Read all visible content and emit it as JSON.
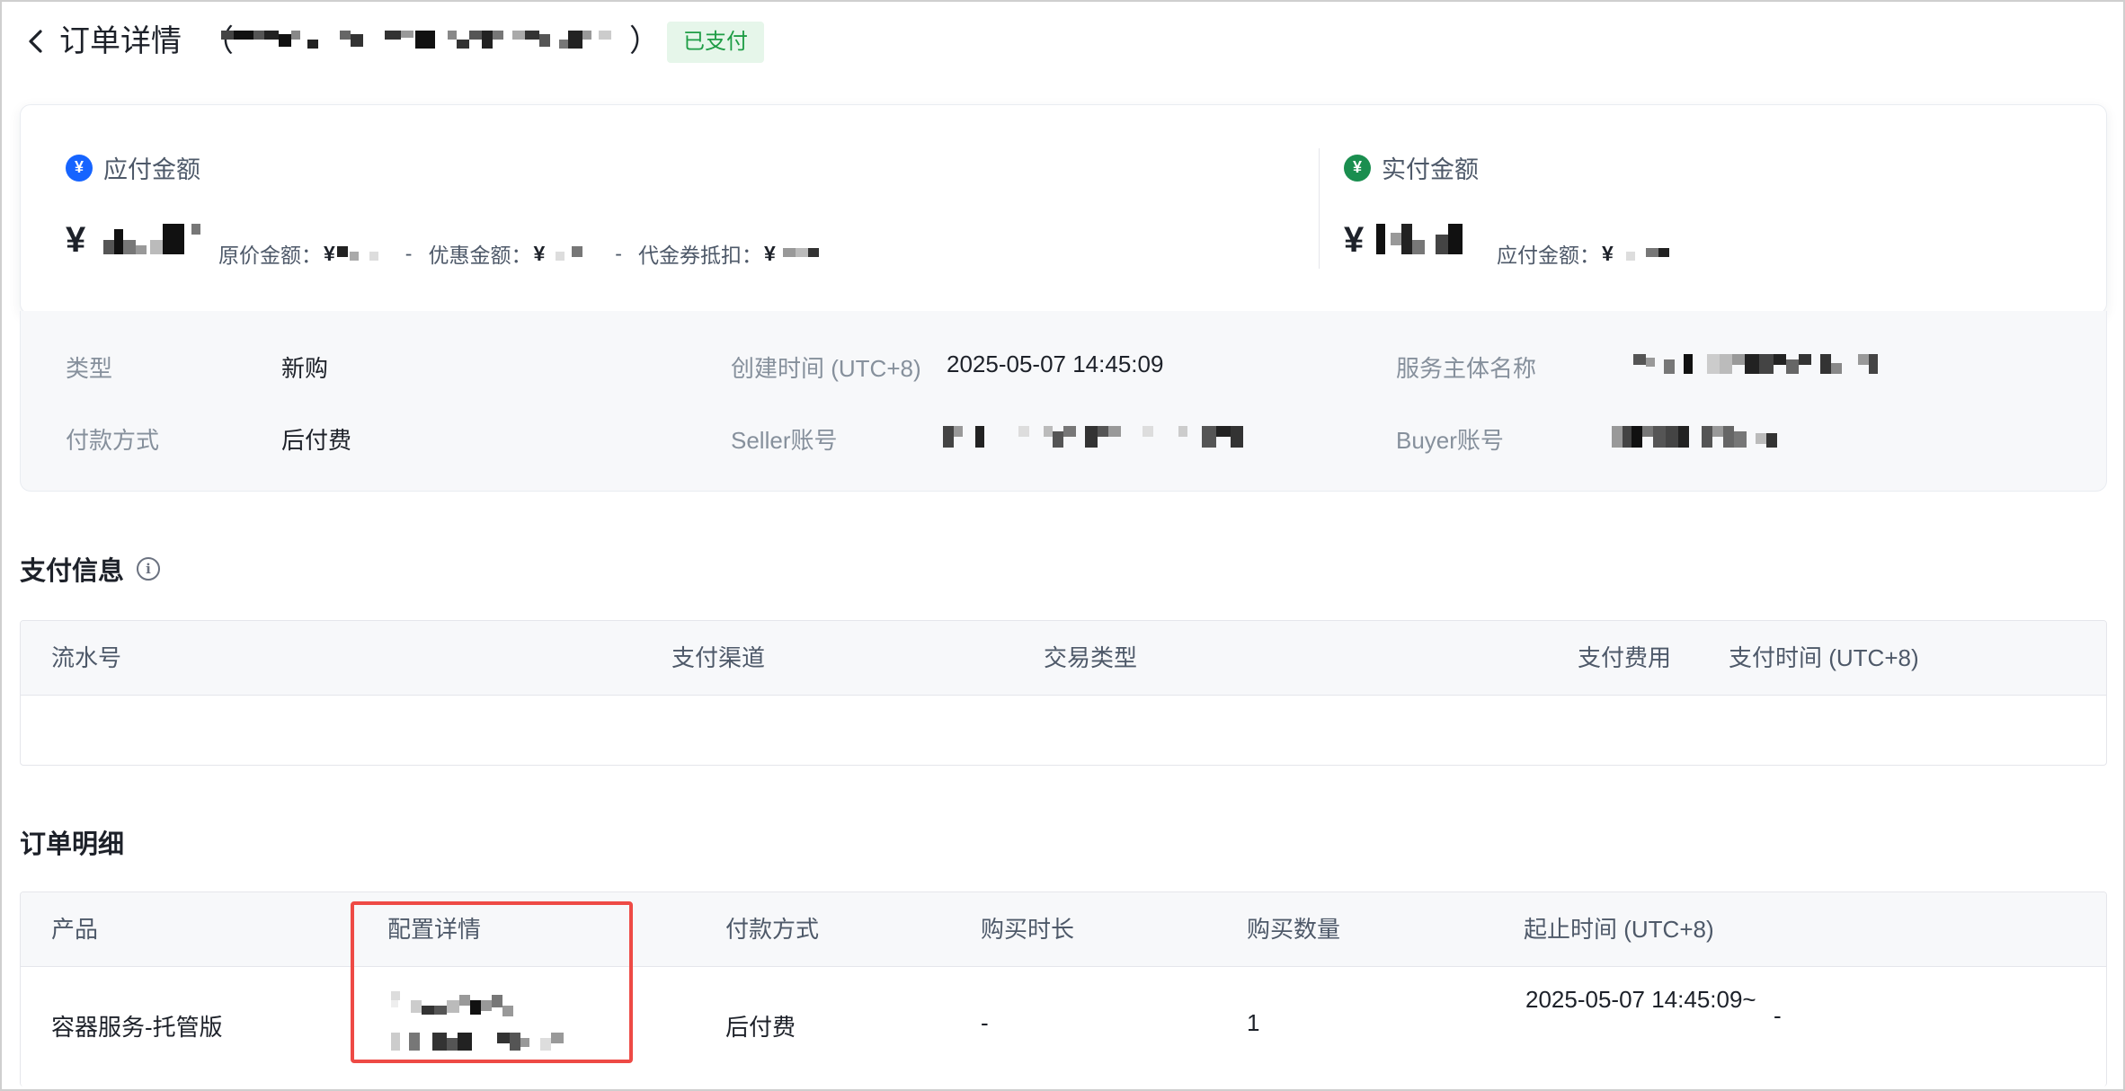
{
  "header": {
    "back_icon": "chevron-left-icon",
    "title": "订单详情",
    "paren_open": "（",
    "paren_close": "）",
    "status_badge": "已支付",
    "status_color": "#1f9d46"
  },
  "amounts": {
    "payable": {
      "icon": "yen-coin-icon",
      "title": "应付金额",
      "currency": "¥",
      "original_label": "原价金额：",
      "minus": "-",
      "discount_label": "优惠金额：",
      "voucher_label": "代金券抵扣：",
      "yen": "¥"
    },
    "paid": {
      "icon": "yen-coin-icon",
      "title": "实付金额",
      "currency": "¥",
      "payable_label": "应付金额：",
      "yen": "¥"
    },
    "colors": {
      "payable_accent": "#1664ff",
      "paid_accent": "#1a8e4f"
    }
  },
  "order_info": {
    "type_label": "类型",
    "type_value": "新购",
    "payment_method_label": "付款方式",
    "payment_method_value": "后付费",
    "created_label": "创建时间 (UTC+8)",
    "created_value": "2025-05-07 14:45:09",
    "seller_label": "Seller账号",
    "service_entity_label": "服务主体名称",
    "buyer_label": "Buyer账号"
  },
  "payment_section": {
    "title": "支付信息",
    "icon": "info-icon",
    "columns": [
      "流水号",
      "支付渠道",
      "交易类型",
      "支付费用",
      "支付时间 (UTC+8)"
    ],
    "rows": []
  },
  "order_items": {
    "title": "订单明细",
    "columns": [
      "产品",
      "配置详情",
      "付款方式",
      "购买时长",
      "购买数量",
      "起止时间 (UTC+8)"
    ],
    "rows": [
      {
        "product": "容器服务-托管版",
        "payment_method": "后付费",
        "duration": "-",
        "quantity": "1",
        "start_end": "2025-05-07 14:45:09~",
        "end": "-"
      }
    ]
  }
}
